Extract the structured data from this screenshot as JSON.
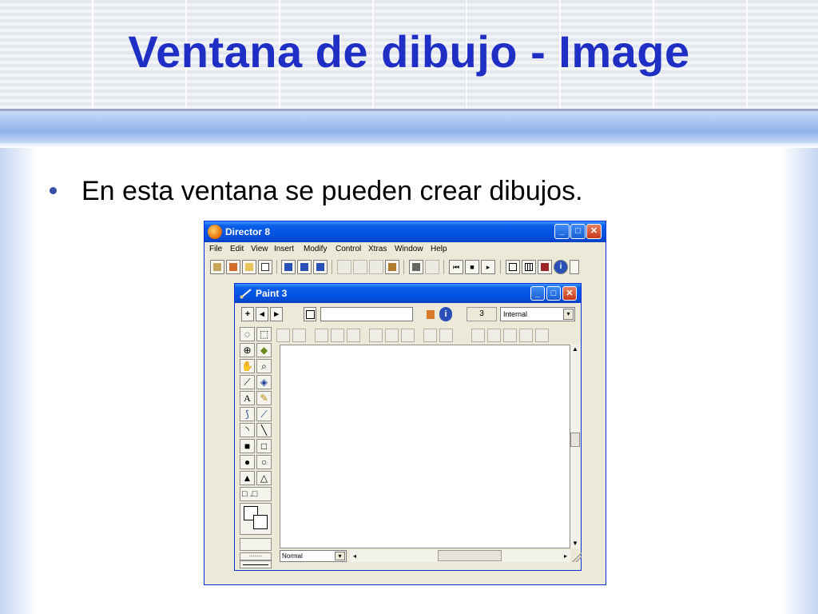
{
  "slide": {
    "title": "Ventana de dibujo - Image",
    "bullet": "En esta ventana se pueden crear dibujos.",
    "colors": {
      "title": "#1f2fc5",
      "bar": "#a8c6f0"
    }
  },
  "director": {
    "title": "Director 8",
    "icon": "director-logo-icon",
    "menu": [
      "File",
      "Edit",
      "View",
      "Insert",
      "Modify",
      "Control",
      "Xtras",
      "Window",
      "Help"
    ],
    "window_buttons": {
      "minimize": "_",
      "maximize": "□",
      "close": "✕"
    }
  },
  "paint": {
    "title": "Paint 3",
    "nav": {
      "add": "+",
      "prev": "◂",
      "next": "▸"
    },
    "member_name": "",
    "member_number": "3",
    "cast": "Internal",
    "ink": "Normal",
    "dropdown_arrow": "▾",
    "scroll": {
      "up": "▲",
      "down": "▼",
      "left": "◂",
      "right": "▸"
    }
  }
}
